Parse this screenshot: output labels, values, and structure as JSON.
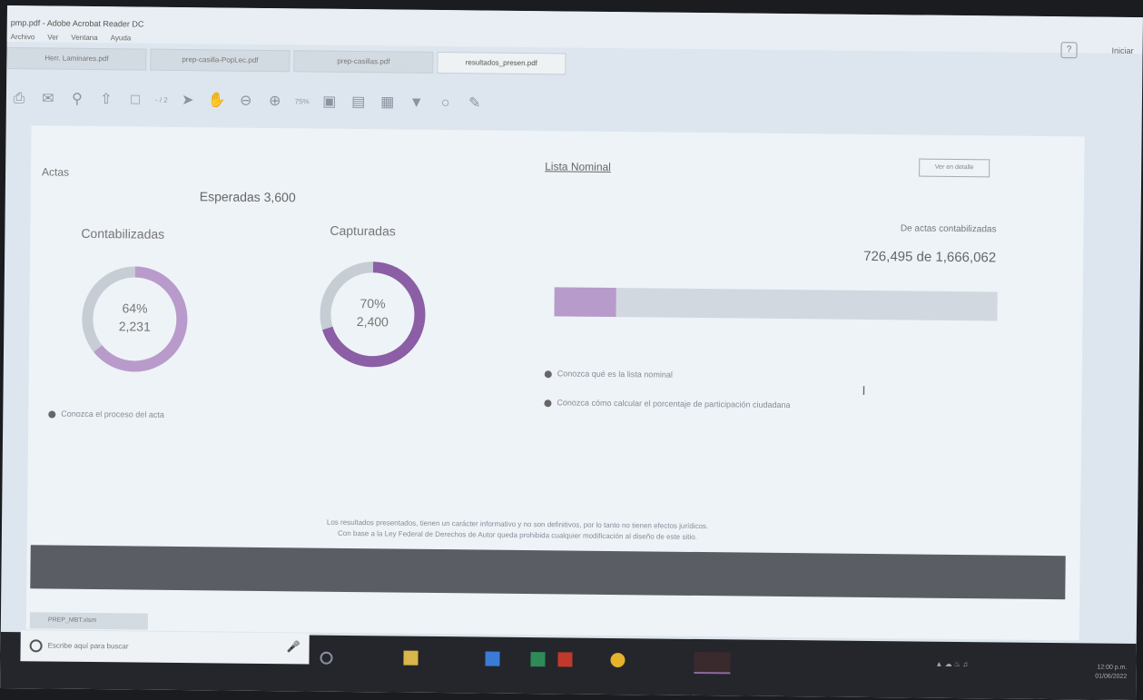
{
  "window": {
    "title": "pmp.pdf - Adobe Acrobat Reader DC",
    "menu": [
      "Archivo",
      "Ver",
      "Ventana",
      "Ayuda"
    ],
    "user": "Iniciar"
  },
  "tabs": [
    {
      "label": "Herr. Laminares.pdf"
    },
    {
      "label": "prep-casilla-PopLec.pdf"
    },
    {
      "label": "prep-casillas.pdf"
    },
    {
      "label": "resultados_presen.pdf"
    }
  ],
  "toolbar": {
    "icons": [
      "print-icon",
      "mail-icon",
      "search-icon",
      "upload-icon",
      "page-icon",
      "cursor-icon",
      "hand-icon",
      "zoom-out-icon",
      "zoom-in-icon",
      "fit-icon",
      "page-view-icon",
      "fullscreen-icon",
      "scroll-icon",
      "comment-icon",
      "pen-icon"
    ],
    "zoom": "75%",
    "page_nav": "- / 2"
  },
  "document": {
    "actas_label": "Actas",
    "esperadas": "Esperadas 3,600",
    "contabilizadas": {
      "label": "Contabilizadas",
      "percent_text": "64%",
      "count_text": "2,231",
      "percent": 64
    },
    "capturadas": {
      "label": "Capturadas",
      "percent_text": "70%",
      "count_text": "2,400",
      "percent": 70
    },
    "conozca_proceso": "Conozca el proceso del acta",
    "lista_nominal_label": "Lista Nominal",
    "small_button": "Ver en detalle",
    "de_actas": "De actas contabilizadas",
    "count_text": "726,495 de 1,666,062",
    "progress_percent": 14,
    "link1": "Conozca qué es la lista nominal",
    "link2": "Conozca cómo calcular el porcentaje de participación ciudadana",
    "disclaimer_line1": "Los resultados presentados, tienen un carácter informativo y no son definitivos, por lo tanto no tienen efectos jurídicos.",
    "disclaimer_line2": "Con base a la Ley Federal de Derechos de Autor queda prohibida cualquier modificación al diseño de este sitio."
  },
  "colors": {
    "donut1": "#b99bcb",
    "donut2": "#8b5ea6",
    "track": "#c6cdd4",
    "progress_fill": "#b79bcb"
  },
  "taskbar": {
    "search_placeholder": "Escribe aquí para buscar",
    "bottom_tab": "PREP_MBT.xlsm",
    "clock": "12:00 p.m.",
    "date": "01/06/2022"
  }
}
